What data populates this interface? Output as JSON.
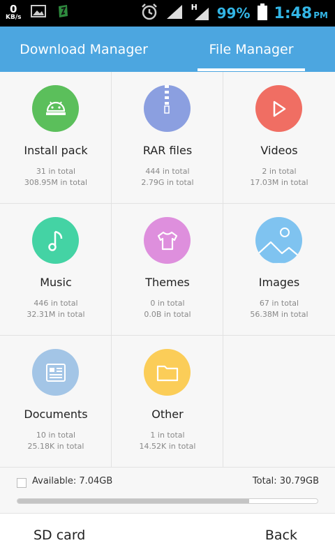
{
  "status_bar": {
    "net_speed": "0",
    "net_unit": "KB/s",
    "network_type": "H",
    "battery": "99%",
    "time": "1:48",
    "ampm": "PM"
  },
  "tabs": [
    {
      "label": "Download Manager",
      "active": false
    },
    {
      "label": "File Manager",
      "active": true
    }
  ],
  "categories": [
    {
      "name": "Install pack",
      "count": "31  in total",
      "size": "308.95M in total",
      "color": "#5bbf5b",
      "icon": "android-icon"
    },
    {
      "name": "RAR files",
      "count": "444  in total",
      "size": "2.79G in total",
      "color": "#8b9fe0",
      "icon": "zipper-icon"
    },
    {
      "name": "Videos",
      "count": "2  in total",
      "size": "17.03M in total",
      "color": "#f06e63",
      "icon": "play-icon"
    },
    {
      "name": "Music",
      "count": "446  in total",
      "size": "32.31M in total",
      "color": "#44d3a4",
      "icon": "music-note-icon"
    },
    {
      "name": "Themes",
      "count": "0  in total",
      "size": "0.0B in total",
      "color": "#de8fdd",
      "icon": "tshirt-icon"
    },
    {
      "name": "Images",
      "count": "67  in total",
      "size": "56.38M in total",
      "color": "#7fc3f0",
      "icon": "image-icon"
    },
    {
      "name": "Documents",
      "count": "10  in total",
      "size": "25.18K in total",
      "color": "#a3c5e6",
      "icon": "document-icon"
    },
    {
      "name": "Other",
      "count": "1  in total",
      "size": "14.52K in total",
      "color": "#fbcd58",
      "icon": "folder-icon"
    }
  ],
  "storage": {
    "available": "Available: 7.04GB",
    "total": "Total: 30.79GB",
    "used_fraction": 0.771
  },
  "bottom": {
    "left": "SD card",
    "right": "Back"
  }
}
